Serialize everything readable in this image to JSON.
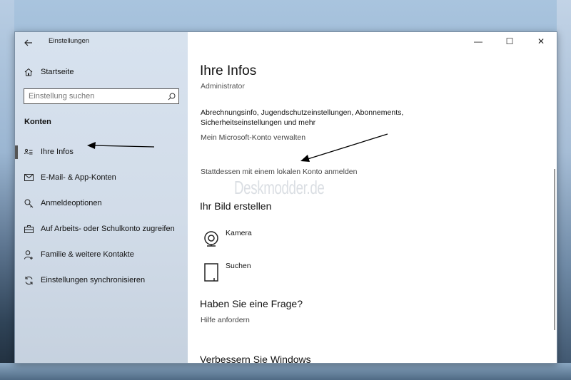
{
  "window": {
    "title": "Einstellungen",
    "back_icon": "back-arrow-icon",
    "minimize_glyph": "—",
    "maximize_glyph": "☐",
    "close_glyph": "✕"
  },
  "sidebar": {
    "home_label": "Startseite",
    "search_placeholder": "Einstellung suchen",
    "section_title": "Konten",
    "items": [
      {
        "label": "Ihre Infos",
        "icon": "person-card-icon",
        "active": true
      },
      {
        "label": "E-Mail- & App-Konten",
        "icon": "mail-icon",
        "active": false
      },
      {
        "label": "Anmeldeoptionen",
        "icon": "key-icon",
        "active": false
      },
      {
        "label": "Auf Arbeits- oder Schulkonto zugreifen",
        "icon": "briefcase-icon",
        "active": false
      },
      {
        "label": "Familie & weitere Kontakte",
        "icon": "person-add-icon",
        "active": false
      },
      {
        "label": "Einstellungen synchronisieren",
        "icon": "sync-icon",
        "active": false
      }
    ]
  },
  "main": {
    "title": "Ihre Infos",
    "account_type": "Administrator",
    "description": "Abrechnungsinfo, Jugendschutzeinstellungen, Abonnements, Sicherheitseinstellungen und mehr",
    "manage_link": "Mein Microsoft-Konto verwalten",
    "local_link": "Stattdessen mit einem lokalen Konto anmelden",
    "picture_heading": "Ihr Bild erstellen",
    "camera_label": "Kamera",
    "browse_label": "Suchen",
    "question_heading": "Haben Sie eine Frage?",
    "help_link": "Hilfe anfordern",
    "improve_heading": "Verbessern Sie Windows"
  },
  "watermark": "Deskmodder.de",
  "colors": {
    "sidebar_bg": "#d3deea",
    "accent_active": "#555555",
    "text": "#111111",
    "link_gray": "#444444"
  }
}
